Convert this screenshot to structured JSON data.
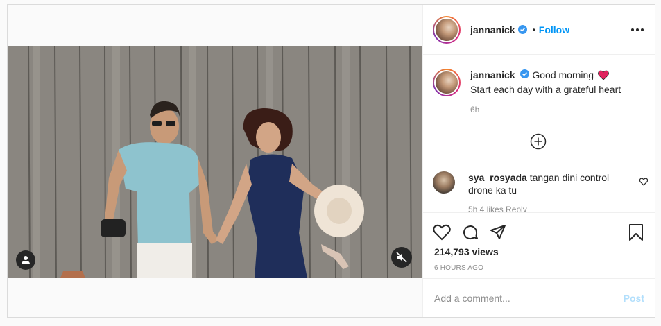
{
  "post": {
    "author": {
      "username": "jannanick",
      "verified": true,
      "follow_label": "Follow",
      "separator": "•"
    },
    "caption": {
      "text_line1": "Good morning",
      "emoji": "red-heart",
      "text_line2": "Start each day with a grateful heart",
      "time": "6h"
    },
    "comments": [
      {
        "username": "sya_rosyada",
        "text": "tangan dini control drone ka tu",
        "meta": "5h  4 likes  Reply"
      }
    ],
    "views": "214,793 views",
    "posted_ago": "6 HOURS AGO",
    "add_comment": {
      "placeholder": "Add a comment...",
      "post_label": "Post"
    },
    "colors": {
      "accent": "#0095f6",
      "post_disabled": "#b2dffc",
      "heart": "#ed4956"
    }
  }
}
